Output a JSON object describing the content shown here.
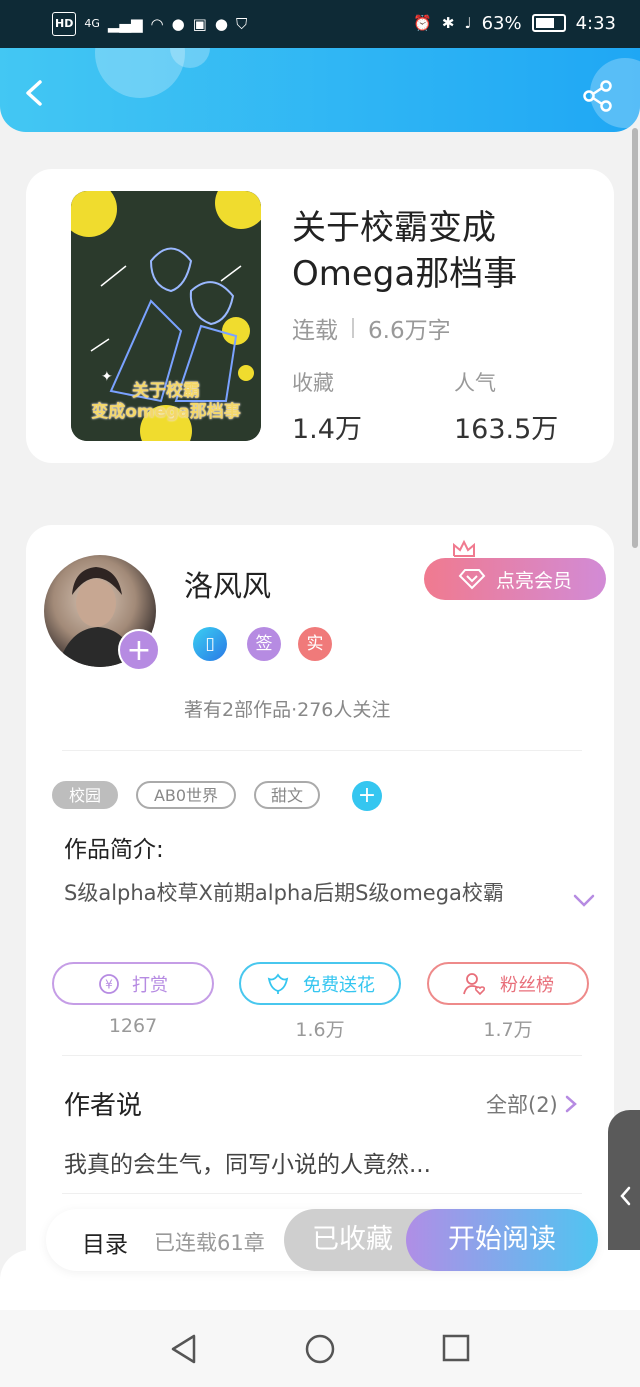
{
  "status_bar": {
    "hd": "HD",
    "signal": "4G",
    "battery_percent": "63%",
    "time": "4:33"
  },
  "book": {
    "title": "关于校霸变成Omega那档事",
    "status": "连载",
    "word_count": "6.6万字",
    "collect_label": "收藏",
    "collect_value": "1.4万",
    "popularity_label": "人气",
    "popularity_value": "163.5万",
    "cover_caption_line1": "关于校霸",
    "cover_caption_line2": "变成omega那档事"
  },
  "author": {
    "name": "洛风风",
    "vip_label": "点亮会员",
    "badge_sign": "签",
    "badge_real": "实",
    "meta": "著有2部作品·276人关注"
  },
  "tags": [
    "校园",
    "AB0世界",
    "甜文"
  ],
  "intro": {
    "title": "作品简介:",
    "text": "S级alpha校草X前期alpha后期S级omega校霸"
  },
  "actions": [
    {
      "label": "打赏",
      "count": "1267"
    },
    {
      "label": "免费送花",
      "count": "1.6万"
    },
    {
      "label": "粉丝榜",
      "count": "1.7万"
    }
  ],
  "author_says": {
    "title": "作者说",
    "all_label": "全部(2)",
    "text": "我真的会生气，同写小说的人竟然..."
  },
  "bottom_bar": {
    "toc": "目录",
    "chapters": "已连载61章",
    "collected": "已收藏",
    "read": "开始阅读"
  },
  "colors": {
    "header_start": "#43c7f3",
    "header_end": "#1fa7f4",
    "accent_purple": "#b68be2",
    "accent_blue": "#35c6f0",
    "accent_red": "#f07a8f"
  }
}
